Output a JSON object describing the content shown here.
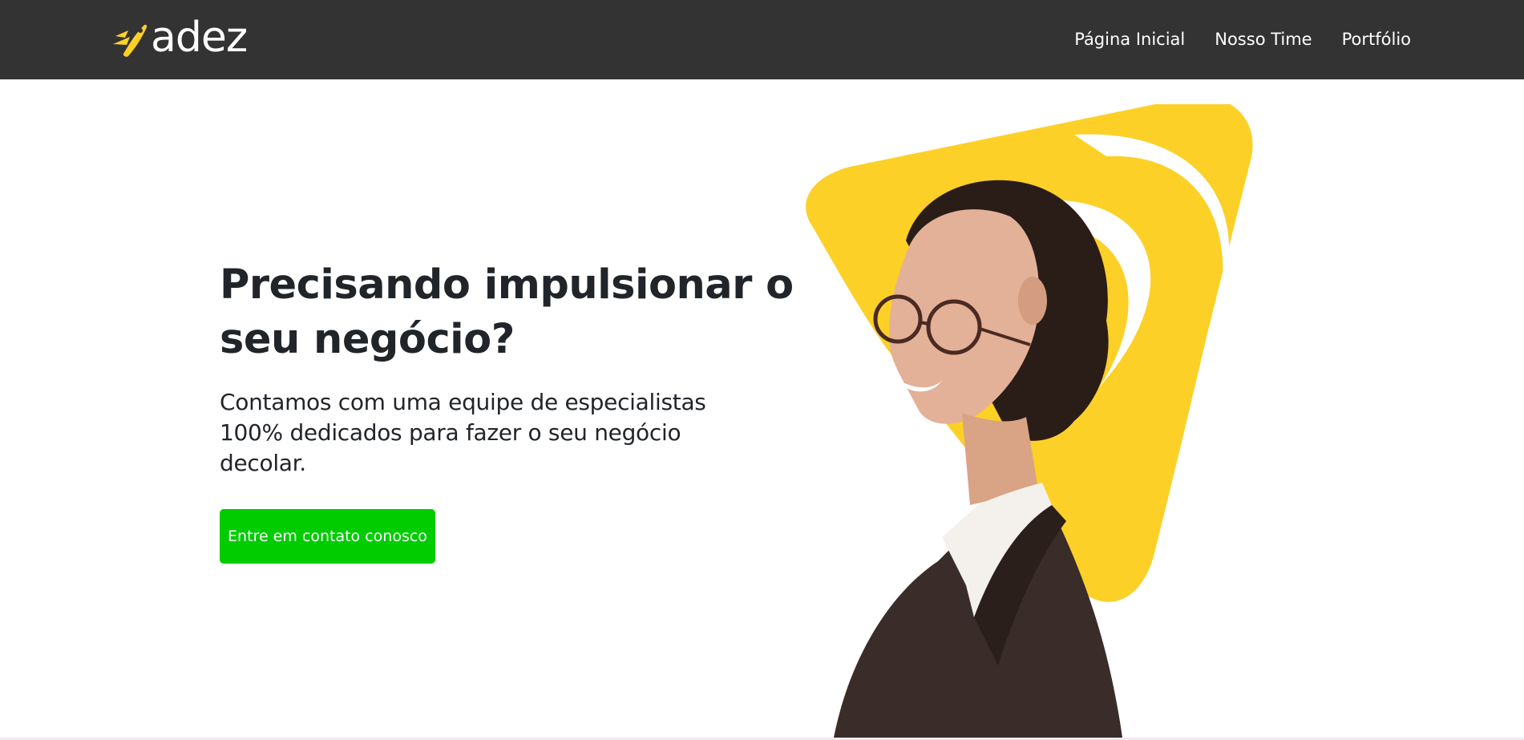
{
  "brand": {
    "logo_text": "adez",
    "logo_icon": "rocket-wing-icon",
    "accent_color": "#fcd027"
  },
  "nav": {
    "items": [
      {
        "label": "Página Inicial"
      },
      {
        "label": "Nosso Time"
      },
      {
        "label": "Portfólio"
      }
    ]
  },
  "hero": {
    "title": "Precisando impulsionar o seu negócio?",
    "subtitle": "Contamos com uma equipe de especialistas 100% dedicados para fazer o seu negócio decolar.",
    "cta_label": "Entre em contato conosco",
    "cta_color": "#00cc00"
  },
  "colors": {
    "header_bg": "#333333",
    "text": "#212529",
    "accent": "#fcd027"
  }
}
